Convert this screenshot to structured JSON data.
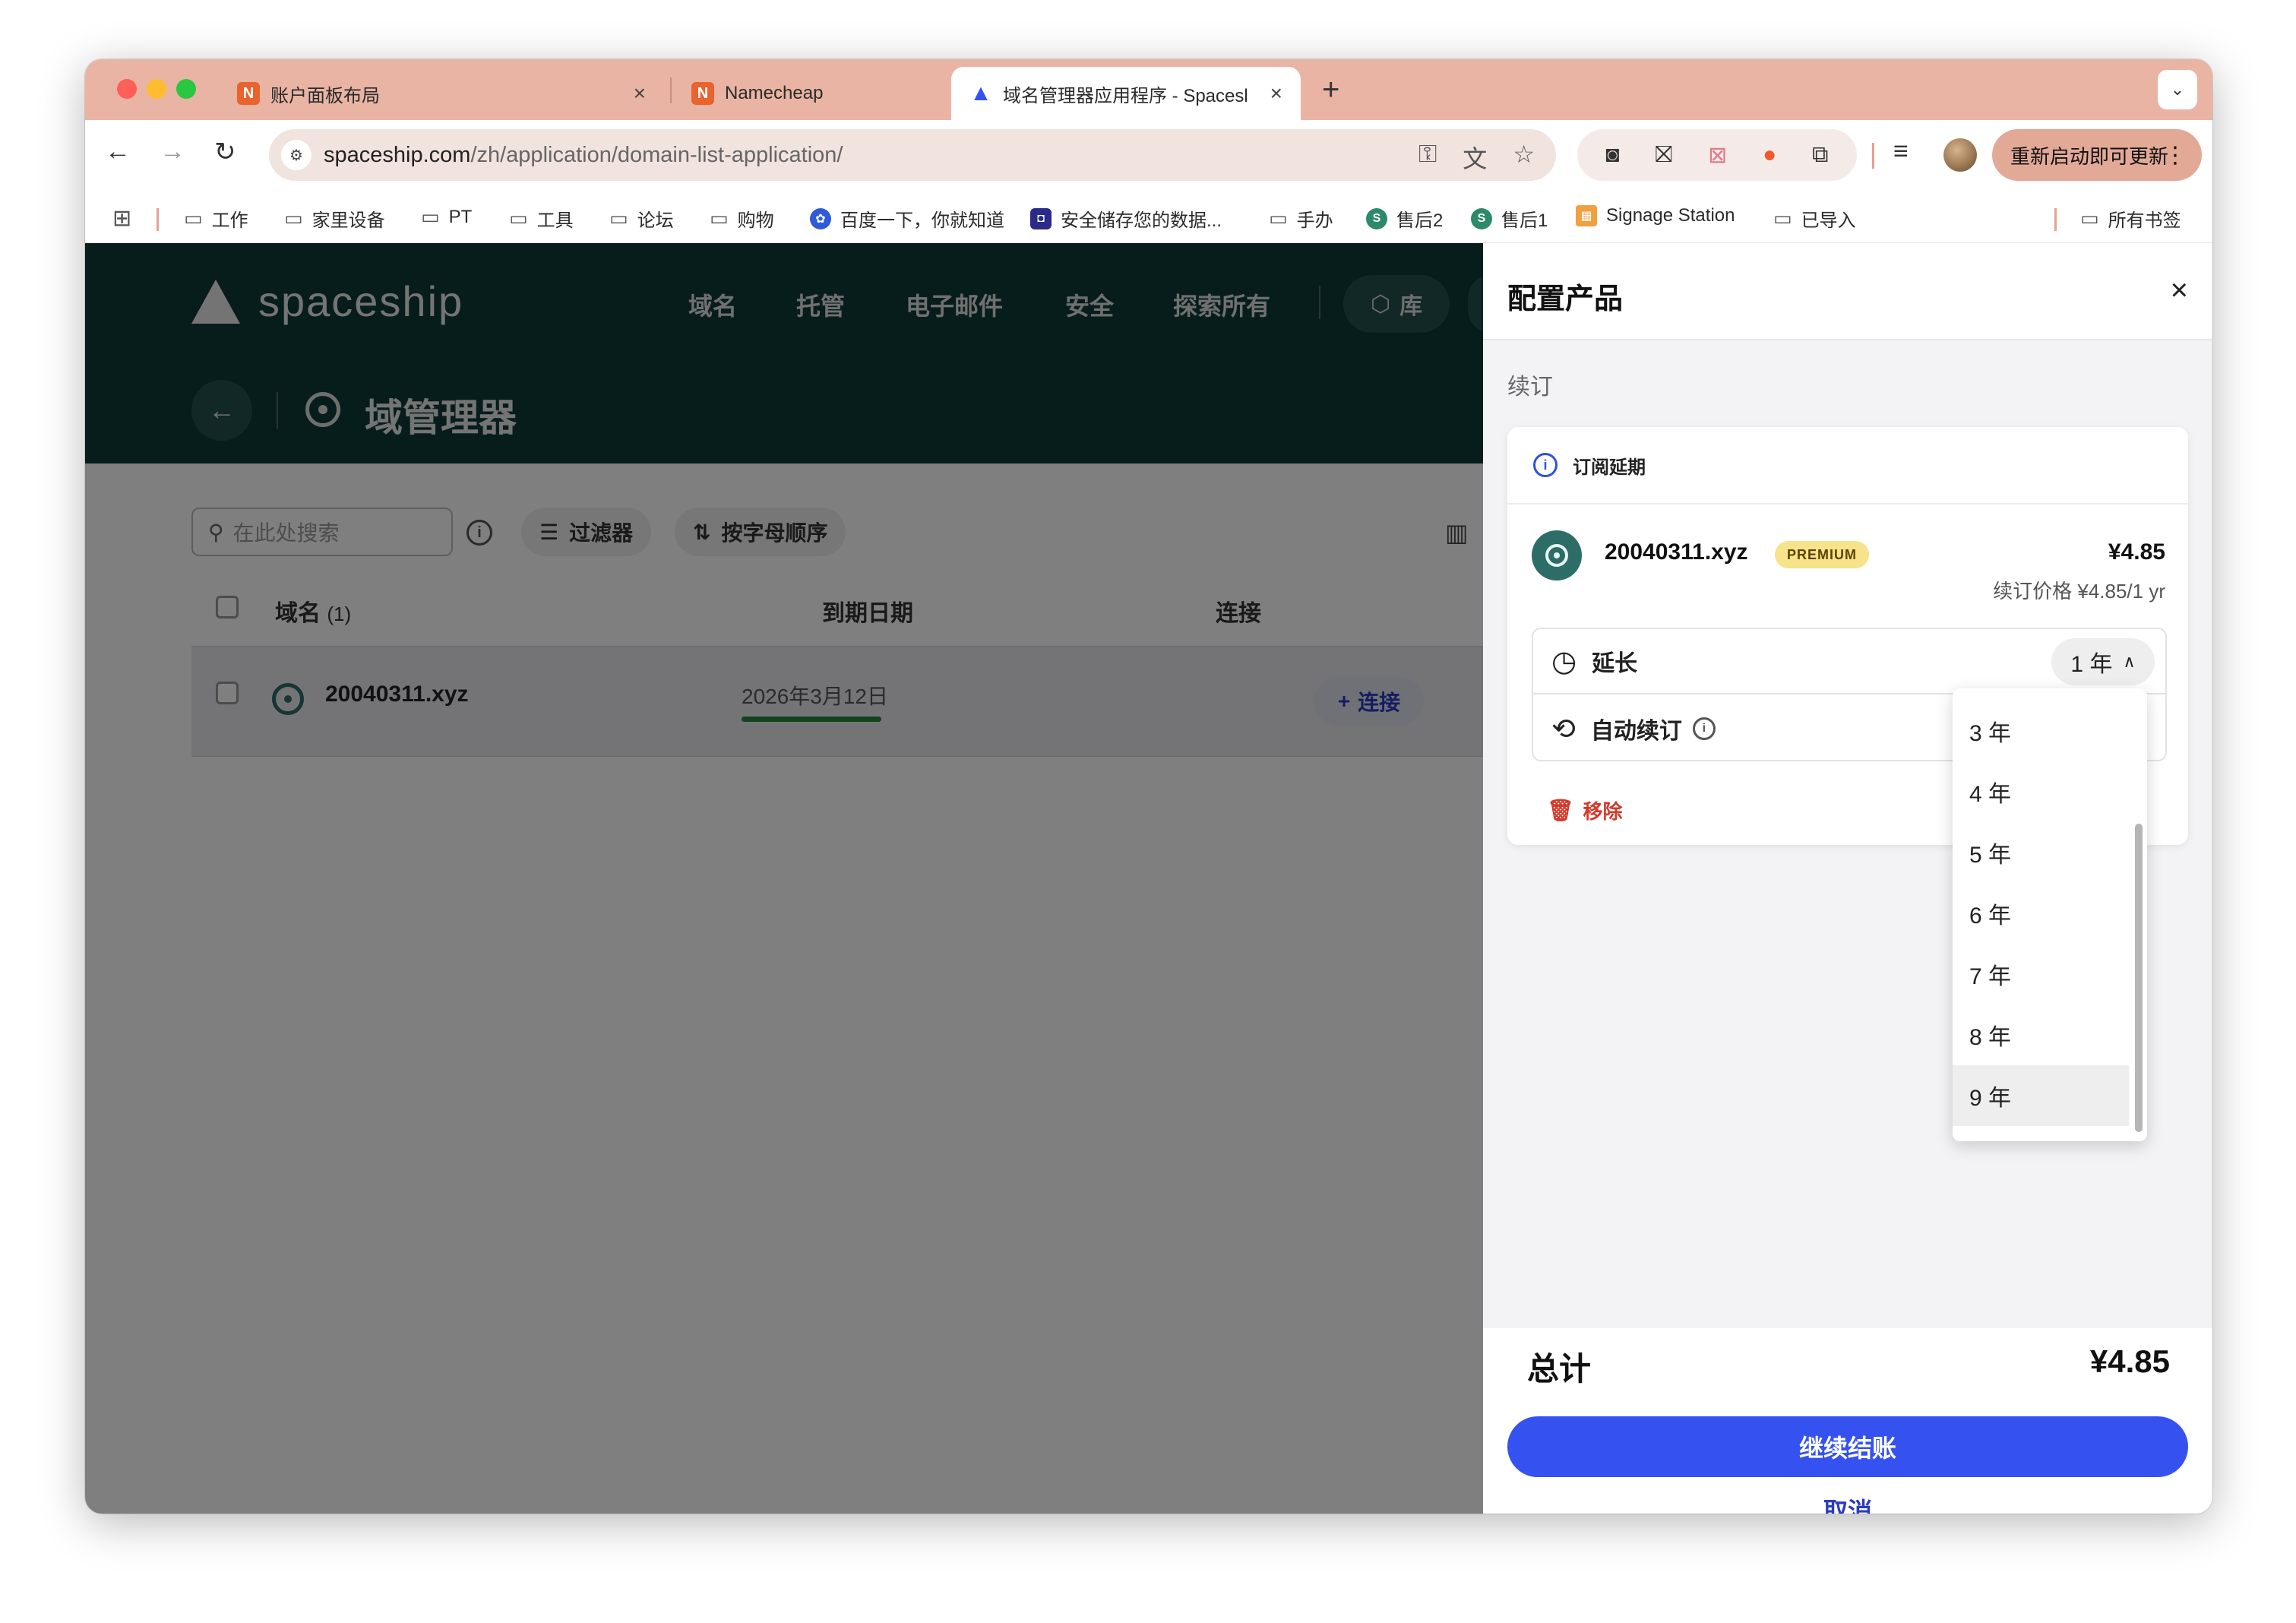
{
  "browser": {
    "tabs": [
      {
        "label": "账户面板布局",
        "favicon": "namecheap-icon",
        "close": "×"
      },
      {
        "label": "Namecheap",
        "favicon": "namecheap-icon",
        "close": "×"
      },
      {
        "label": "域名管理器应用程序 - Spacesl",
        "favicon": "spaceship-icon",
        "close": "×",
        "active": true
      }
    ],
    "new_tab": "+",
    "tab_menu": "⌄",
    "url_host": "spaceship.com",
    "url_path": "/zh/application/domain-list-application/",
    "update_label": "重新启动即可更新",
    "menu_dots": "⋮",
    "bookmarks": [
      {
        "label": "工作",
        "icon": "folder-icon"
      },
      {
        "label": "家里设备",
        "icon": "folder-icon"
      },
      {
        "label": "PT",
        "icon": "folder-icon"
      },
      {
        "label": "工具",
        "icon": "folder-icon"
      },
      {
        "label": "论坛",
        "icon": "folder-icon"
      },
      {
        "label": "购物",
        "icon": "folder-icon"
      },
      {
        "label": "百度一下，你就知道",
        "icon": "baidu-icon"
      },
      {
        "label": "安全储存您的数据...",
        "icon": "secure-storage-icon"
      },
      {
        "label": "手办",
        "icon": "folder-icon"
      },
      {
        "label": "售后2",
        "icon": "s-icon"
      },
      {
        "label": "售后1",
        "icon": "s-icon"
      },
      {
        "label": "Signage Station",
        "icon": "signage-icon"
      },
      {
        "label": "已导入",
        "icon": "folder-icon"
      },
      {
        "label": "所有书签",
        "icon": "folder-icon"
      }
    ]
  },
  "site": {
    "logo_text": "spaceship",
    "nav": [
      "域名",
      "托管",
      "电子邮件",
      "安全",
      "探索所有"
    ],
    "library_label": "库",
    "page_title": "域管理器",
    "search_placeholder": "在此处搜索",
    "filter_label": "过滤器",
    "sort_label": "按字母顺序",
    "table": {
      "col_domain": "域名",
      "col_domain_count": "(1)",
      "col_expiry": "到期日期",
      "col_connect": "连接",
      "rows": [
        {
          "domain": "20040311.xyz",
          "expiry": "2026年3月12日",
          "connect": "连接"
        }
      ]
    }
  },
  "drawer": {
    "title": "配置产品",
    "close": "×",
    "section": "续订",
    "card_header": "订阅延期",
    "product_name": "20040311.xyz",
    "badge": "PREMIUM",
    "price": "¥4.85",
    "renew_price": "续订价格 ¥4.85/1 yr",
    "extend_label": "延长",
    "selected_years": "1 年",
    "auto_renew_label": "自动续订",
    "remove_label": "移除",
    "year_options": [
      "3 年",
      "4 年",
      "5 年",
      "6 年",
      "7 年",
      "8 年",
      "9 年"
    ],
    "highlighted_option": "9 年",
    "total_label": "总计",
    "total_value": "¥4.85",
    "checkout_label": "继续结账",
    "cancel_label": "取消"
  },
  "colors": {
    "tabbar": "#e9b4a3",
    "site_header": "#0e3a38",
    "accent_blue": "#3552f0",
    "teal": "#2c6d68",
    "danger": "#d23a2a",
    "premium_badge": "#f6e38a"
  }
}
